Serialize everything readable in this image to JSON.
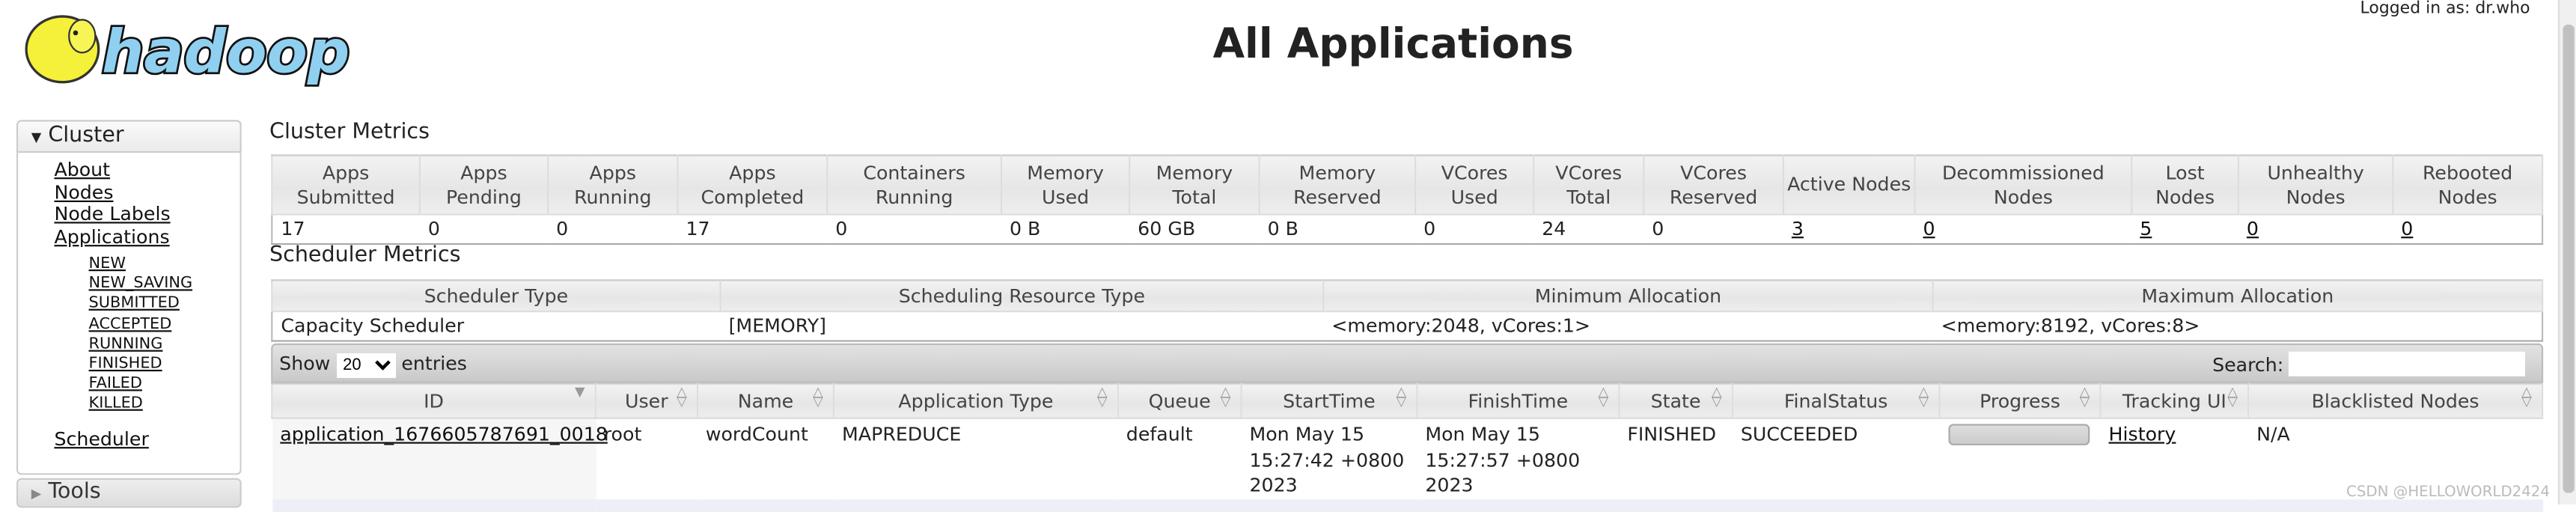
{
  "header": {
    "logo_text": "hadoop",
    "title": "All Applications",
    "login": "Logged in as: dr.who"
  },
  "sidebar": {
    "cluster_label": "Cluster",
    "items": [
      {
        "label": "About"
      },
      {
        "label": "Nodes"
      },
      {
        "label": "Node Labels"
      },
      {
        "label": "Applications"
      }
    ],
    "app_states": [
      {
        "label": "NEW"
      },
      {
        "label": "NEW_SAVING"
      },
      {
        "label": "SUBMITTED"
      },
      {
        "label": "ACCEPTED"
      },
      {
        "label": "RUNNING"
      },
      {
        "label": "FINISHED"
      },
      {
        "label": "FAILED"
      },
      {
        "label": "KILLED"
      }
    ],
    "scheduler": "Scheduler",
    "tools_label": "Tools"
  },
  "cluster_metrics": {
    "title": "Cluster Metrics",
    "headers": [
      "Apps Submitted",
      "Apps Pending",
      "Apps Running",
      "Apps Completed",
      "Containers Running",
      "Memory Used",
      "Memory Total",
      "Memory Reserved",
      "VCores Used",
      "VCores Total",
      "VCores Reserved",
      "Active Nodes",
      "Decommissioned Nodes",
      "Lost Nodes",
      "Unhealthy Nodes",
      "Rebooted Nodes"
    ],
    "values": [
      "17",
      "0",
      "0",
      "17",
      "0",
      "0 B",
      "60 GB",
      "0 B",
      "0",
      "24",
      "0",
      "3",
      "0",
      "5",
      "0",
      "0"
    ]
  },
  "scheduler_metrics": {
    "title": "Scheduler Metrics",
    "headers": [
      "Scheduler Type",
      "Scheduling Resource Type",
      "Minimum Allocation",
      "Maximum Allocation"
    ],
    "values": [
      "Capacity Scheduler",
      "[MEMORY]",
      "<memory:2048, vCores:1>",
      "<memory:8192, vCores:8>"
    ]
  },
  "toolbar": {
    "show": "Show",
    "entries_value": "20",
    "entries": "entries",
    "search": "Search:",
    "search_value": ""
  },
  "apps": {
    "headers": [
      "ID",
      "User",
      "Name",
      "Application Type",
      "Queue",
      "StartTime",
      "FinishTime",
      "State",
      "FinalStatus",
      "Progress",
      "Tracking UI",
      "Blacklisted Nodes"
    ],
    "rows": [
      {
        "id": "application_1676605787691_0018",
        "user": "root",
        "name": "wordCount",
        "type": "MAPREDUCE",
        "queue": "default",
        "start": "Mon May 15 15:27:42 +0800 2023",
        "finish": "Mon May 15 15:27:57 +0800 2023",
        "state": "FINISHED",
        "final": "SUCCEEDED",
        "progress": 100,
        "tracking": "History",
        "blacklisted": "N/A"
      }
    ]
  },
  "watermark": "CSDN @HELLOWORLD2424"
}
